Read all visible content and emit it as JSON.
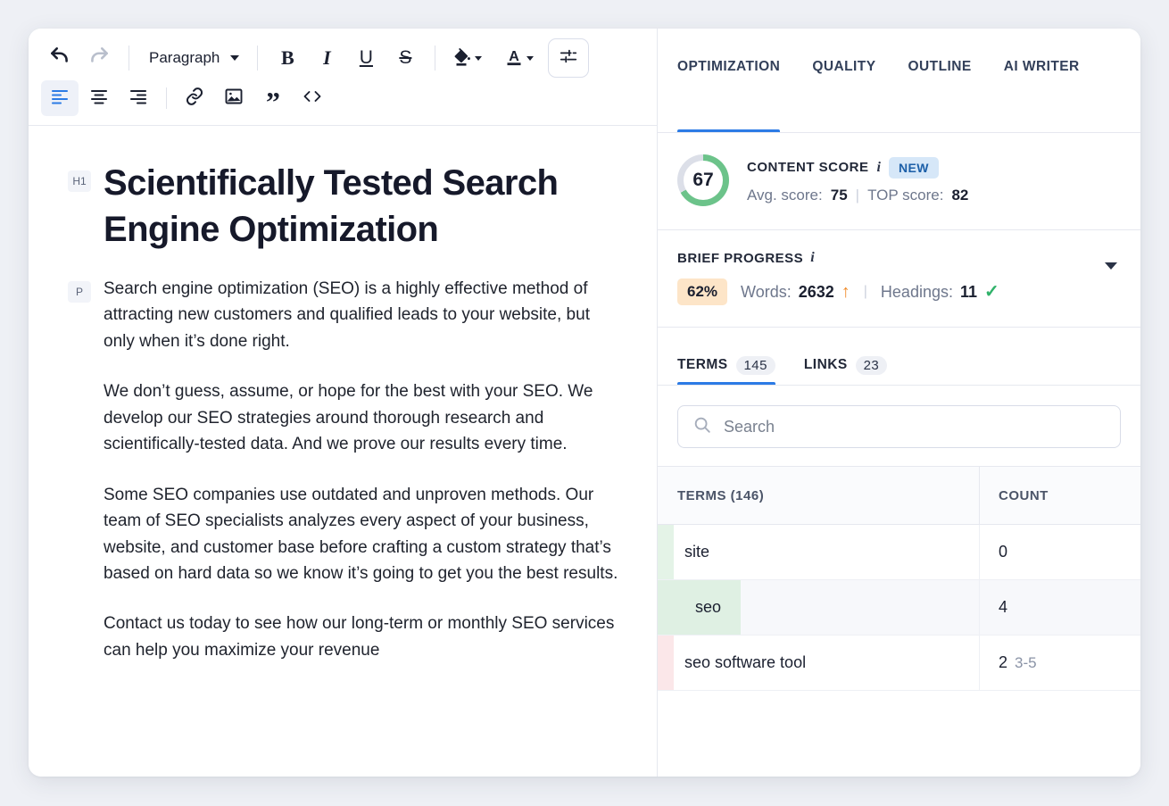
{
  "editor": {
    "toolbar": {
      "undo": "undo-icon",
      "redo": "redo-icon",
      "block_format": "Paragraph",
      "bold": "B",
      "italic": "I",
      "underline": "U",
      "strikethrough": "S",
      "highlight_color": "fill-color-icon",
      "text_color": "A",
      "align_left": "align-left-icon",
      "align_center": "align-center-icon",
      "align_right": "align-right-icon",
      "link": "link-icon",
      "image": "image-icon",
      "quote": "quote-icon",
      "code": "code-icon",
      "settings": "tune-icon"
    },
    "document": {
      "h1_tag": "H1",
      "p_tag": "P",
      "title": "Scientifically Tested Search Engine Optimization",
      "paragraphs": [
        "Search engine optimization (SEO) is a highly effective method of attracting new customers and qualified leads to your website, but only when it’s done right.",
        "We don’t guess, assume, or hope for the best with your SEO. We develop our SEO strategies around thorough research and scientifically-tested data. And we prove our results every time.",
        "Some SEO companies use outdated and unproven methods. Our team of SEO specialists analyzes every aspect of your business, website, and customer base before crafting a custom strategy that’s based on hard data so we know it’s going to get you the best results.",
        "Contact us today to see how our long-term or monthly SEO services can help you maximize your revenue"
      ]
    }
  },
  "panel": {
    "tabs": [
      {
        "label": "OPTIMIZATION",
        "active": true
      },
      {
        "label": "QUALITY",
        "active": false
      },
      {
        "label": "OUTLINE",
        "active": false
      },
      {
        "label": "AI WRITER",
        "active": false
      }
    ],
    "content_score": {
      "value": "67",
      "label": "CONTENT SCORE",
      "info_icon": "info-icon",
      "badge": "NEW",
      "avg_label": "Avg. score:",
      "avg_value": "75",
      "divider": "|",
      "top_label": "TOP score:",
      "top_value": "82",
      "ring_color": "#6cc38a",
      "ring_track": "#dcdfe8",
      "percent": 67
    },
    "brief_progress": {
      "label": "BRIEF PROGRESS",
      "info_icon": "info-icon",
      "percent": "62%",
      "words_label": "Words:",
      "words_value": "2632",
      "words_status_icon": "arrow-up-icon",
      "words_status_char": "↑",
      "divider": "|",
      "headings_label": "Headings:",
      "headings_value": "11",
      "headings_status_icon": "check-icon",
      "headings_status_char": "✓",
      "percent_bg": "#fde5c8",
      "arrow_color": "#f08b2b",
      "check_color": "#30b26a"
    },
    "terms_links_tabs": [
      {
        "label": "TERMS",
        "count": "145",
        "active": true
      },
      {
        "label": "LINKS",
        "count": "23",
        "active": false
      }
    ],
    "search": {
      "placeholder": "Search",
      "value": "",
      "icon": "search-icon"
    },
    "table": {
      "columns": [
        "TERMS (146)",
        "COUNT"
      ],
      "rows": [
        {
          "term": "site",
          "count": "0",
          "range": "",
          "stripe": "#e4f3e7",
          "mark": false,
          "highlighted": false
        },
        {
          "term": "seo",
          "count": "4",
          "range": "",
          "stripe": "#dff0e3",
          "mark": true,
          "highlighted": true
        },
        {
          "term": "seo software tool",
          "count": "2",
          "range": "3-5",
          "stripe": "#fbe7e9",
          "mark": false,
          "highlighted": false
        }
      ]
    }
  }
}
